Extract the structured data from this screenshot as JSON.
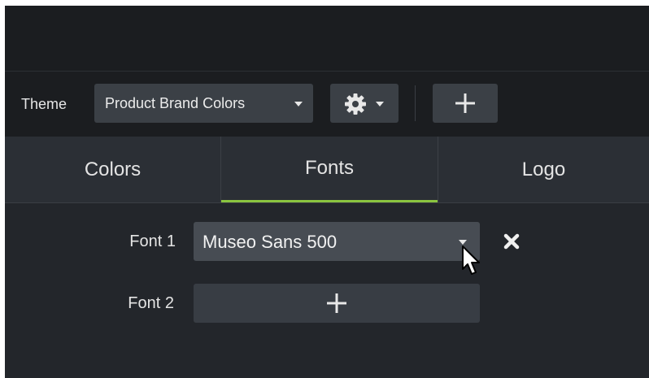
{
  "toolbar": {
    "theme_label": "Theme",
    "theme_value": "Product Brand Colors",
    "gear_icon": "gear-icon",
    "add_icon": "plus-icon"
  },
  "tabs": [
    {
      "label": "Colors",
      "active": false
    },
    {
      "label": "Fonts",
      "active": true
    },
    {
      "label": "Logo",
      "active": false
    }
  ],
  "fonts": {
    "font1_label": "Font 1",
    "font1_value": "Museo Sans 500",
    "font2_label": "Font 2",
    "remove_icon": "close-icon",
    "add_icon": "plus-icon"
  },
  "colors": {
    "accent": "#8ac43f",
    "background": "#23262b",
    "toolbar": "#1b1d20"
  }
}
